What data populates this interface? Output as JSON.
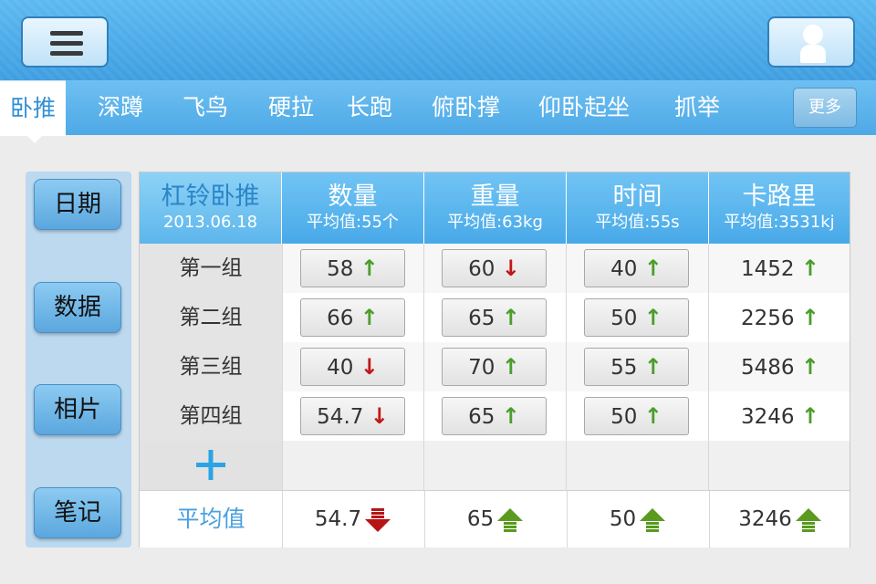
{
  "header": {
    "menu_icon": "hamburger-menu-icon",
    "user_icon": "user-avatar-icon"
  },
  "tabs": [
    {
      "label": "卧推",
      "active": true
    },
    {
      "label": "深蹲"
    },
    {
      "label": "飞鸟"
    },
    {
      "label": "硬拉"
    },
    {
      "label": "长跑"
    },
    {
      "label": "俯卧撑"
    },
    {
      "label": "仰卧起坐"
    },
    {
      "label": "抓举"
    }
  ],
  "more_label": "更多",
  "sidebar": [
    {
      "label": "日期"
    },
    {
      "label": "数据"
    },
    {
      "label": "相片"
    },
    {
      "label": "笔记"
    }
  ],
  "table": {
    "title": "杠铃卧推",
    "date": "2013.06.18",
    "columns": [
      {
        "title": "数量",
        "avg": "平均值:55个"
      },
      {
        "title": "重量",
        "avg": "平均值:63kg"
      },
      {
        "title": "时间",
        "avg": "平均值:55s"
      },
      {
        "title": "卡路里",
        "avg": "平均值:3531kj"
      }
    ],
    "rows": [
      {
        "label": "第一组",
        "cells": [
          {
            "v": "58",
            "dir": "up"
          },
          {
            "v": "60",
            "dir": "down"
          },
          {
            "v": "40",
            "dir": "up"
          },
          {
            "v": "1452",
            "dir": "up"
          }
        ]
      },
      {
        "label": "第二组",
        "cells": [
          {
            "v": "66",
            "dir": "up"
          },
          {
            "v": "65",
            "dir": "up"
          },
          {
            "v": "50",
            "dir": "up"
          },
          {
            "v": "2256",
            "dir": "up"
          }
        ]
      },
      {
        "label": "第三组",
        "cells": [
          {
            "v": "40",
            "dir": "down"
          },
          {
            "v": "70",
            "dir": "up"
          },
          {
            "v": "55",
            "dir": "up"
          },
          {
            "v": "5486",
            "dir": "up"
          }
        ]
      },
      {
        "label": "第四组",
        "cells": [
          {
            "v": "54.7",
            "dir": "down"
          },
          {
            "v": "65",
            "dir": "up"
          },
          {
            "v": "50",
            "dir": "up"
          },
          {
            "v": "3246",
            "dir": "up"
          }
        ]
      }
    ],
    "add_icon": "plus-icon",
    "avg_label": "平均值",
    "avg_values": [
      {
        "v": "54.7",
        "dir": "down"
      },
      {
        "v": "65",
        "dir": "up"
      },
      {
        "v": "50",
        "dir": "up"
      },
      {
        "v": "3246",
        "dir": "up"
      }
    ]
  },
  "colors": {
    "accent": "#4aa0de",
    "up": "#4a9e2a",
    "down": "#c01818"
  }
}
